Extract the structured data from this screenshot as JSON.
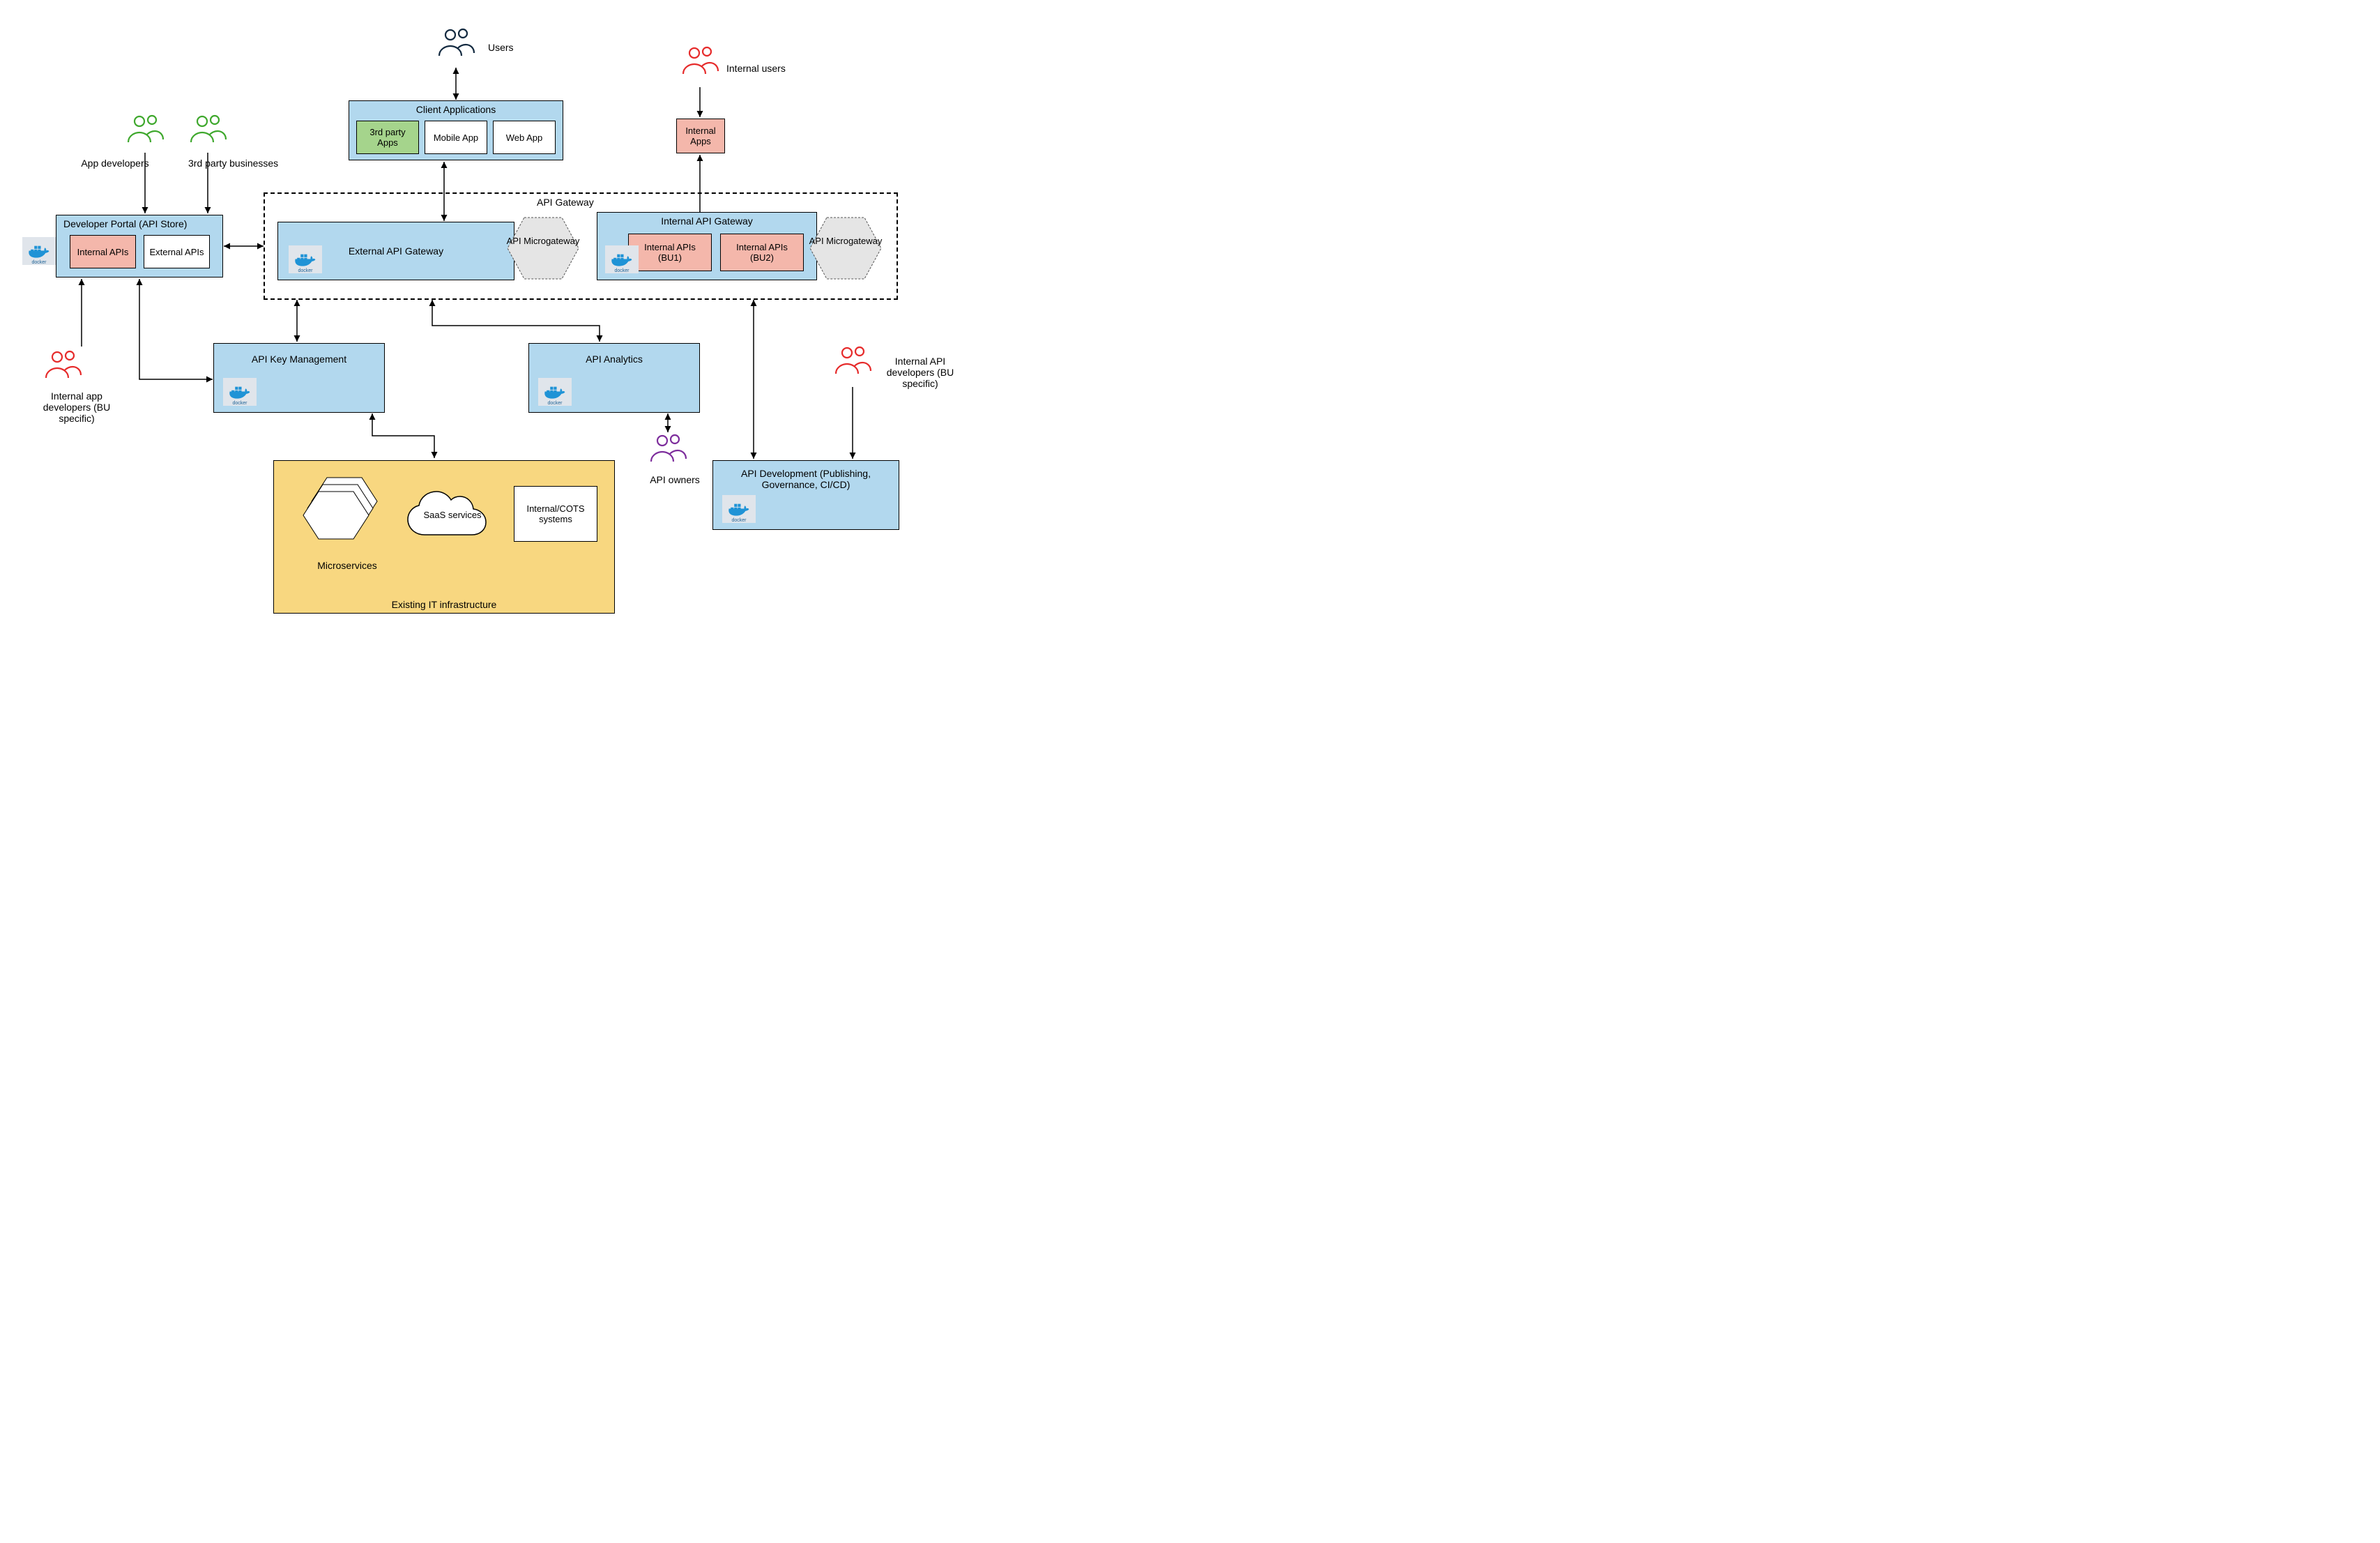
{
  "actors": {
    "users": "Users",
    "internal_users": "Internal users",
    "app_developers": "App developers",
    "third_party_businesses": "3rd party businesses",
    "internal_app_developers": "Internal app developers (BU specific)",
    "api_owners": "API owners",
    "internal_api_developers": "Internal API developers (BU specific)"
  },
  "client_apps": {
    "title": "Client Applications",
    "items": [
      "3rd party Apps",
      "Mobile App",
      "Web App"
    ]
  },
  "internal_apps": "Internal Apps",
  "developer_portal": {
    "title": "Developer Portal (API Store)",
    "items": [
      "Internal APIs",
      "External APIs"
    ]
  },
  "api_gateway": {
    "title": "API Gateway",
    "external": "External API Gateway",
    "microgateway": "API Microgateway",
    "internal": {
      "title": "Internal API Gateway",
      "items": [
        "Internal APIs (BU1)",
        "Internal APIs (BU2)"
      ]
    }
  },
  "api_key_mgmt": "API Key Management",
  "api_analytics": "API Analytics",
  "api_development": "API Development (Publishing, Governance, CI/CD)",
  "infrastructure": {
    "title": "Existing IT infrastructure",
    "microservices": "Microservices",
    "saas": "SaaS services",
    "cots": "Internal/COTS systems"
  },
  "icons": {
    "docker": "docker"
  }
}
